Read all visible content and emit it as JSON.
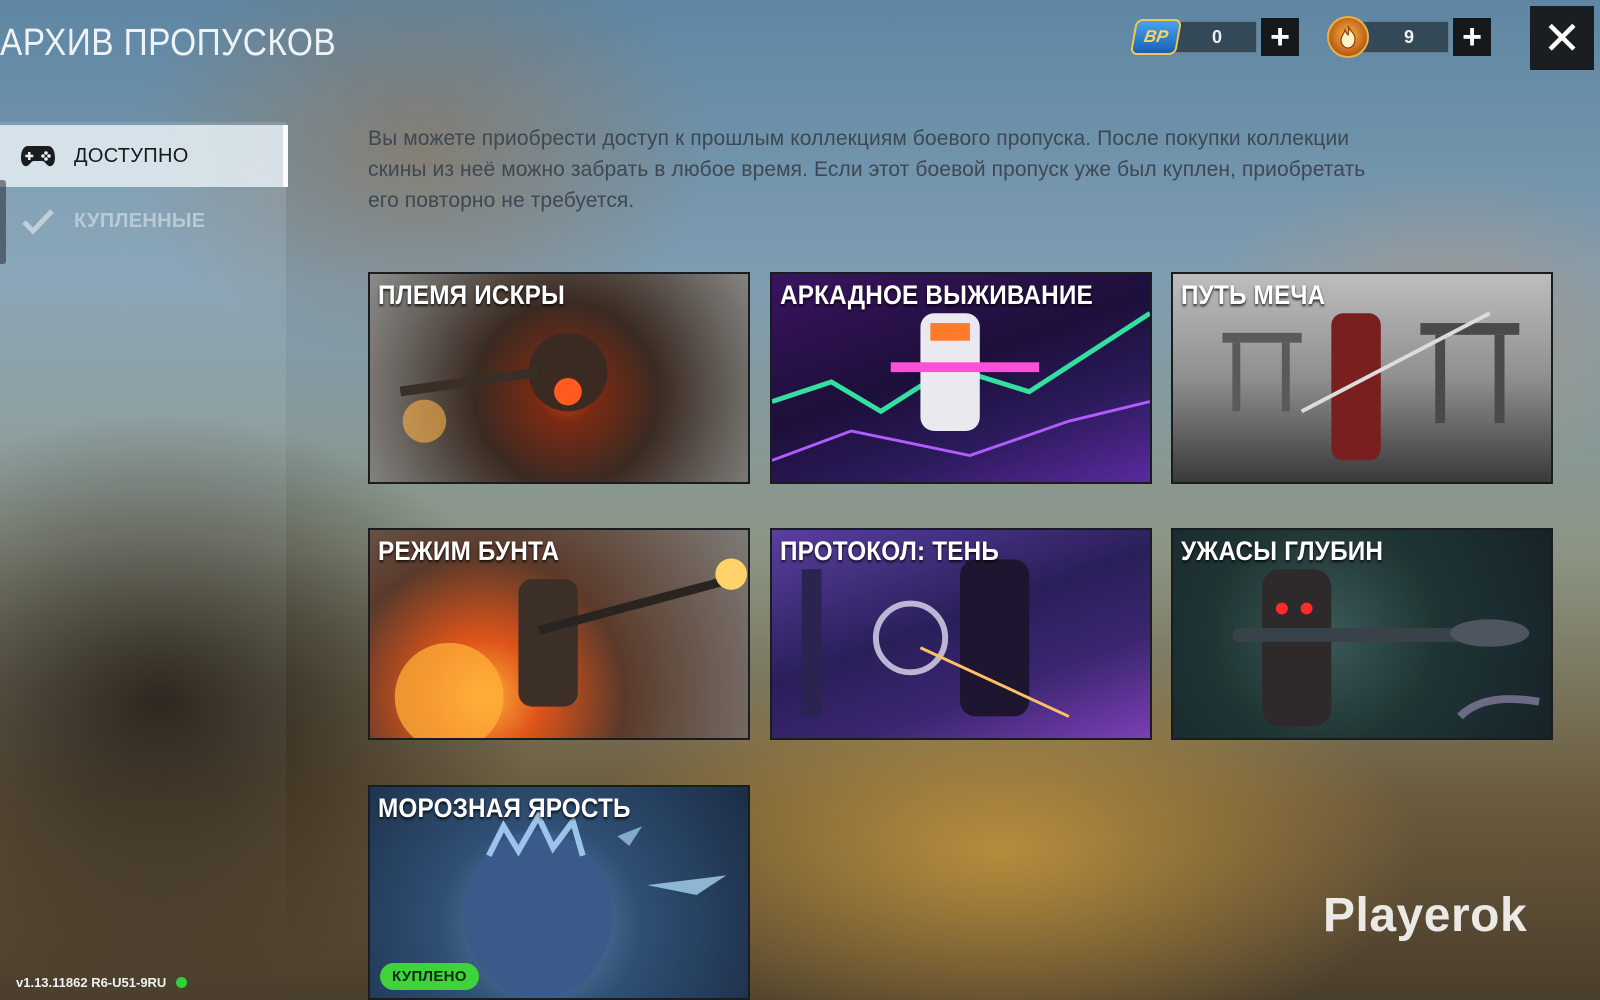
{
  "header": {
    "title": "АРХИВ ПРОПУСКОВ",
    "currencies": [
      {
        "icon": "bp-coin-icon",
        "badge_text": "BP",
        "value": "0"
      },
      {
        "icon": "fire-coin-icon",
        "value": "9"
      }
    ],
    "plus_symbol": "+",
    "close_symbol": "✕"
  },
  "sidebar": {
    "items": [
      {
        "label": "ДОСТУПНО",
        "icon": "gamepad-icon",
        "active": true
      },
      {
        "label": "КУПЛЕННЫЕ",
        "icon": "checkmark-icon",
        "active": false
      }
    ]
  },
  "description": "Вы можете приобрести доступ к прошлым коллекциям боевого пропуска. После покупки коллекции скины из неё можно забрать в любое время. Если этот боевой пропуск уже был куплен, приобретать его повторно не требуется.",
  "passes": [
    {
      "title": "ПЛЕМЯ ИСКРЫ"
    },
    {
      "title": "АРКАДНОЕ ВЫЖИВАНИЕ"
    },
    {
      "title": "ПУТЬ МЕЧА"
    },
    {
      "title": "РЕЖИМ БУНТА"
    },
    {
      "title": "ПРОТОКОЛ: ТЕНЬ"
    },
    {
      "title": "УЖАСЫ ГЛУБИН"
    },
    {
      "title": "МОРОЗНАЯ ЯРОСТЬ",
      "badge": "КУПЛЕНО"
    }
  ],
  "footer": {
    "version": "v1.13.11862 R6-U51-9RU",
    "watermark": "Playerok"
  },
  "colors": {
    "accent_badge": "#3fd33b",
    "status_online": "#2ed13a"
  }
}
